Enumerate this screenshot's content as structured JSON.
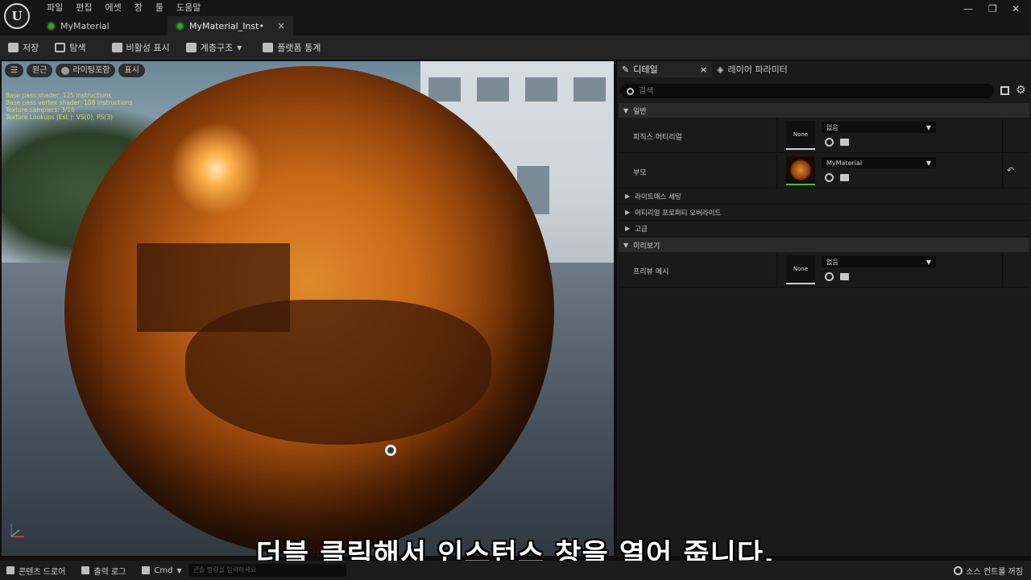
{
  "menu": [
    "파일",
    "편집",
    "에셋",
    "창",
    "툴",
    "도움말"
  ],
  "tabs": [
    {
      "label": "MyMaterial"
    },
    {
      "label": "MyMaterial_Inst•",
      "close": "×"
    }
  ],
  "window_controls": {
    "minimize": "—",
    "restore": "❐",
    "close": "✕"
  },
  "toolbar": {
    "save": "저장",
    "browse": "탐색",
    "hide_inactive": "비활성 표시",
    "hierarchy": "계층구조",
    "platform_stats": "플랫폼 통계"
  },
  "viewport": {
    "menu_icon": "☰",
    "perspective": "원근",
    "lit": "라이팅포함",
    "show": "표시",
    "stats": [
      "Base pass shader: 125 instructions",
      "Base pass vertex shader: 108 instructions",
      "Texture samplers: 3/16",
      "Texture Lookups (Est.): VS(0), PS(3)"
    ]
  },
  "subtitle": "더블 클릭해서 인스턴스 창을 열어 줍니다.",
  "details": {
    "tab_details": "디테일",
    "tab_close": "×",
    "tab_layers": "레이어 파라미터",
    "search_placeholder": "검색",
    "sections": {
      "general": "일반",
      "preview": "미리보기"
    },
    "props": {
      "physical_material": {
        "label": "피직스 머티리얼",
        "thumb": "None",
        "value": "없음"
      },
      "parent": {
        "label": "부모",
        "value": "MyMaterial"
      },
      "preview_mesh": {
        "label": "프리뷰 메시",
        "thumb": "None",
        "value": "없음"
      }
    },
    "subgroups": [
      "라이트매스 세팅",
      "머티리얼 프로퍼티 오버라이드",
      "고급"
    ],
    "reset": "↶"
  },
  "statusbar": {
    "content_drawer": "콘텐츠 드로어",
    "output_log": "출력 로그",
    "cmd": "Cmd",
    "cmd_placeholder": "콘솔 명령을 입력하세요",
    "source_control": "소스 컨트롤 꺼짐"
  }
}
